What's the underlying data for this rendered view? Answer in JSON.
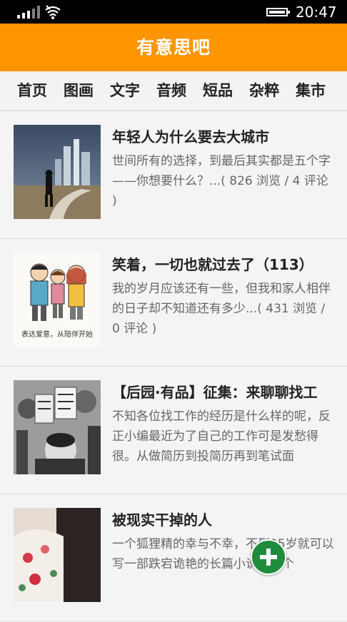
{
  "status_bar": {
    "time": "20:47",
    "icons": [
      "signal-icon",
      "wifi-icon",
      "battery-icon"
    ]
  },
  "app": {
    "title": "有意思吧",
    "accent_color": "#ff9500"
  },
  "tabs": [
    {
      "label": "首页"
    },
    {
      "label": "图画"
    },
    {
      "label": "文字"
    },
    {
      "label": "音频"
    },
    {
      "label": "短品"
    },
    {
      "label": "杂粹"
    },
    {
      "label": "集市"
    }
  ],
  "articles": [
    {
      "title": "年轻人为什么要去大城市",
      "summary": "世间所有的选择，到最后其实都是五个字——你想要什么？...( 826 浏览 / 4 评论 )"
    },
    {
      "title": "笑着，一切也就过去了（113）",
      "summary": "我的岁月应该还有一些，但我和家人相伴的日子却不知道还有多少...( 431 浏览 / 0 评论 )",
      "thumb_caption": "表达爱意，从陪伴开始"
    },
    {
      "title": "【后园·有品】征集：来聊聊找工",
      "summary": "不知各位找工作的经历是什么样的呢，反正小编最近为了自己的工作可是发愁得很。从做简历到投简历再到笔试面"
    },
    {
      "title": "被现实干掉的人",
      "summary": "一个狐狸精的幸与不幸，不到25岁就可以写一部跌宕诡艳的长篇小说，一个"
    }
  ],
  "fab": {
    "icon": "plus-icon"
  }
}
